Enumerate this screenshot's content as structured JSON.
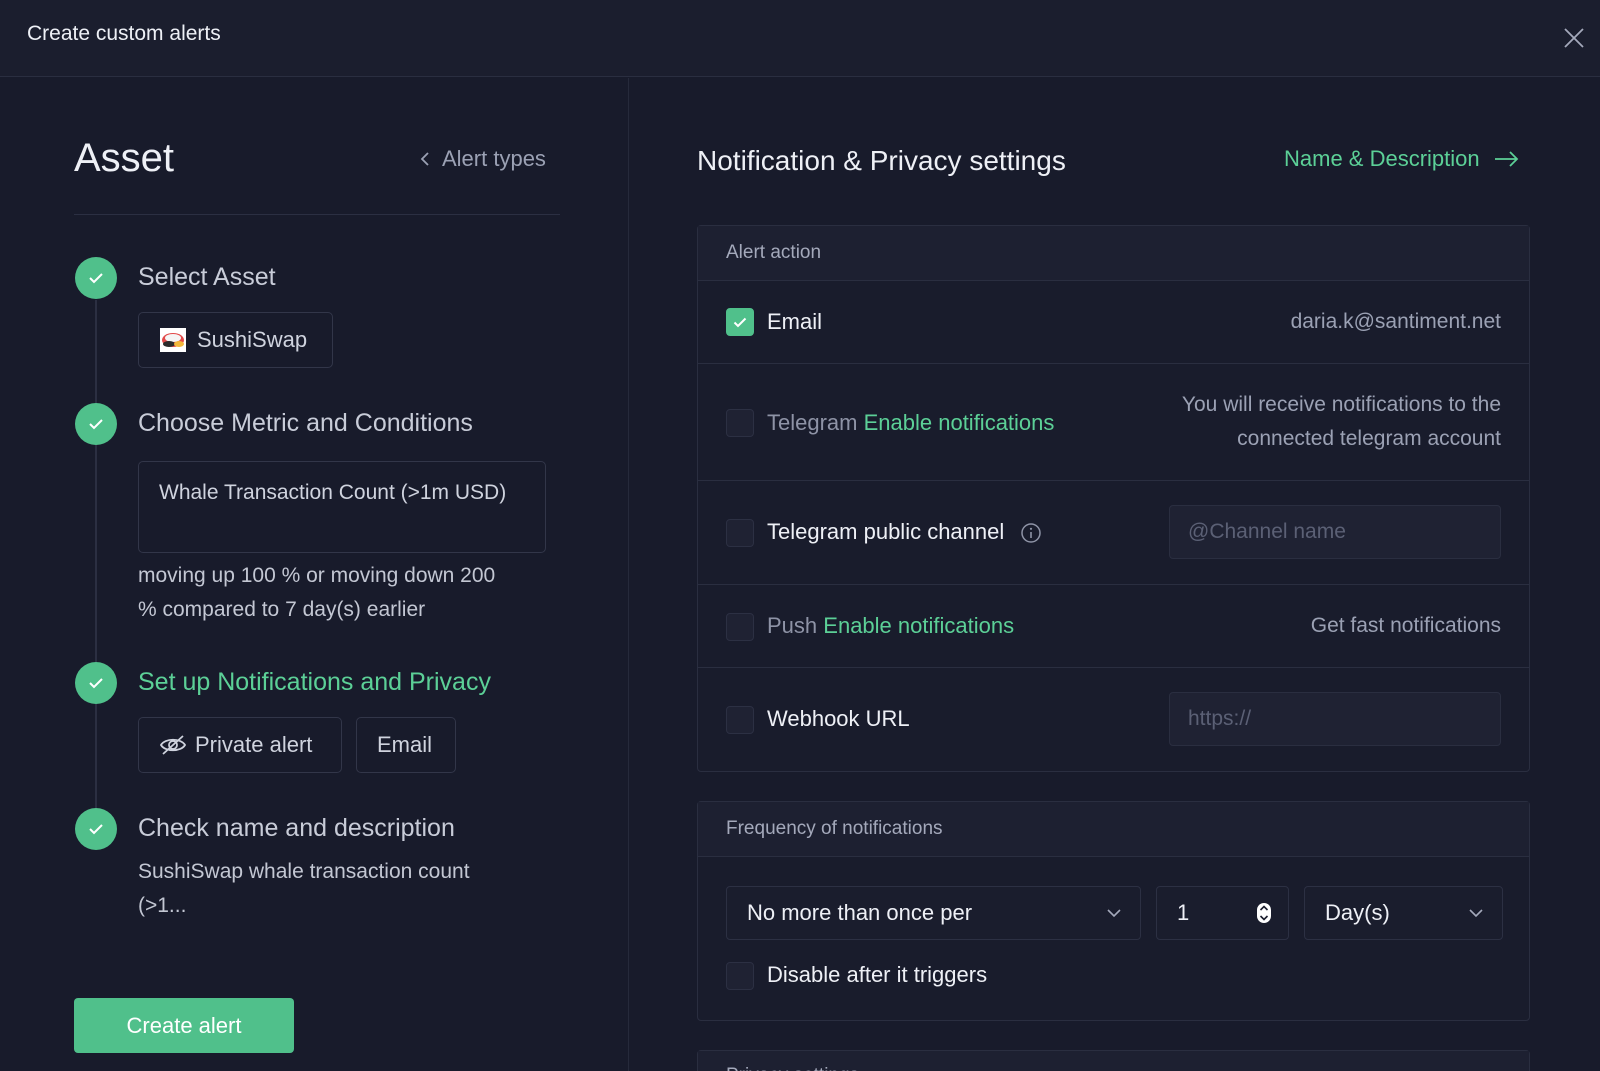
{
  "window": {
    "title": "Create custom alerts"
  },
  "left": {
    "title": "Asset",
    "back_link": "Alert types",
    "steps": [
      {
        "title": "Select Asset",
        "asset": "SushiSwap"
      },
      {
        "title": "Choose Metric and Conditions",
        "metric": "Whale Transaction Count (>1m USD)",
        "condition_line1": "moving up 100 % or moving down 200",
        "condition_line2": "% compared to 7 day(s) earlier"
      },
      {
        "title": "Set up Notifications and Privacy",
        "chip_private": "Private alert",
        "chip_email": "Email"
      },
      {
        "title": "Check name and description",
        "desc_line1": "SushiSwap whale transaction count",
        "desc_line2": "(>1..."
      }
    ],
    "create_button": "Create alert"
  },
  "right": {
    "title": "Notification & Privacy settings",
    "next_link": "Name & Description",
    "alert_action": {
      "header": "Alert action",
      "email": {
        "label": "Email",
        "checked": true,
        "value": "daria.k@santiment.net"
      },
      "telegram": {
        "label": "Telegram",
        "link": "Enable notifications",
        "note_line1": "You will receive notifications to the",
        "note_line2": "connected telegram account"
      },
      "telegram_channel": {
        "label": "Telegram public channel",
        "placeholder": "@Channel name"
      },
      "push": {
        "label": "Push",
        "link": "Enable notifications",
        "note": "Get fast notifications"
      },
      "webhook": {
        "label": "Webhook URL",
        "placeholder": "https://"
      }
    },
    "frequency": {
      "header": "Frequency of notifications",
      "mode": "No more than once per",
      "count": "1",
      "unit": "Day(s)",
      "disable_label": "Disable after it triggers"
    },
    "privacy": {
      "header": "Privacy settings"
    }
  },
  "colors": {
    "accent": "#50c08b",
    "background": "#181b2b",
    "panel": "#1d2031"
  }
}
